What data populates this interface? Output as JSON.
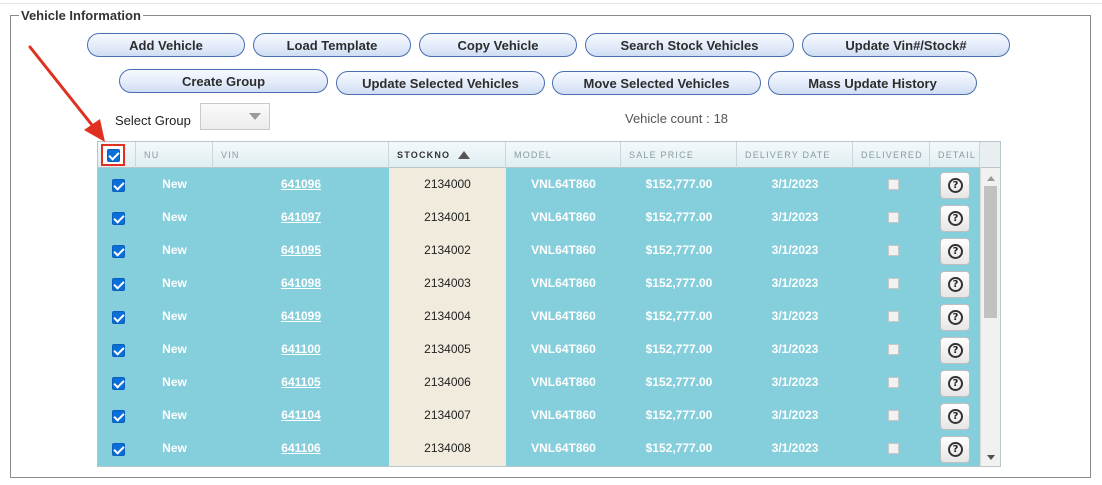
{
  "fieldset": {
    "legend": "Vehicle Information"
  },
  "toolbar": {
    "row1": [
      "Add Vehicle",
      "Load Template",
      "Copy Vehicle",
      "Search Stock Vehicles",
      "Update Vin#/Stock#"
    ],
    "row2": [
      "Create Group",
      "Update Selected Vehicles",
      "Move Selected Vehicles",
      "Mass Update History"
    ]
  },
  "select_group": {
    "label": "Select Group",
    "value": ""
  },
  "vehicle_count": {
    "label": "Vehicle count :",
    "value": "18"
  },
  "grid": {
    "columns": [
      "NU",
      "VIN",
      "STOCKNO",
      "MODEL",
      "SALE PRICE",
      "DELIVERY DATE",
      "DELIVERED",
      "DETAIL"
    ],
    "sorted_column": "STOCKNO",
    "sort_direction": "ascending",
    "header_checkbox_checked": true,
    "rows": [
      {
        "nu": "New",
        "vin": "641096",
        "stockno": "2134000",
        "model": "VNL64T860",
        "sale_price": "$152,777.00",
        "delivery_date": "3/1/2023",
        "delivered": false,
        "checked": true
      },
      {
        "nu": "New",
        "vin": "641097",
        "stockno": "2134001",
        "model": "VNL64T860",
        "sale_price": "$152,777.00",
        "delivery_date": "3/1/2023",
        "delivered": false,
        "checked": true
      },
      {
        "nu": "New",
        "vin": "641095",
        "stockno": "2134002",
        "model": "VNL64T860",
        "sale_price": "$152,777.00",
        "delivery_date": "3/1/2023",
        "delivered": false,
        "checked": true
      },
      {
        "nu": "New",
        "vin": "641098",
        "stockno": "2134003",
        "model": "VNL64T860",
        "sale_price": "$152,777.00",
        "delivery_date": "3/1/2023",
        "delivered": false,
        "checked": true
      },
      {
        "nu": "New",
        "vin": "641099",
        "stockno": "2134004",
        "model": "VNL64T860",
        "sale_price": "$152,777.00",
        "delivery_date": "3/1/2023",
        "delivered": false,
        "checked": true
      },
      {
        "nu": "New",
        "vin": "641100",
        "stockno": "2134005",
        "model": "VNL64T860",
        "sale_price": "$152,777.00",
        "delivery_date": "3/1/2023",
        "delivered": false,
        "checked": true
      },
      {
        "nu": "New",
        "vin": "641105",
        "stockno": "2134006",
        "model": "VNL64T860",
        "sale_price": "$152,777.00",
        "delivery_date": "3/1/2023",
        "delivered": false,
        "checked": true
      },
      {
        "nu": "New",
        "vin": "641104",
        "stockno": "2134007",
        "model": "VNL64T860",
        "sale_price": "$152,777.00",
        "delivery_date": "3/1/2023",
        "delivered": false,
        "checked": true
      },
      {
        "nu": "New",
        "vin": "641106",
        "stockno": "2134008",
        "model": "VNL64T860",
        "sale_price": "$152,777.00",
        "delivery_date": "3/1/2023",
        "delivered": false,
        "checked": true
      }
    ]
  },
  "icons": {
    "detail": "help-icon",
    "sort": "sort-ascending-icon",
    "annotation": "red-arrow-annotation"
  },
  "colors": {
    "row_bg": "#85cedb",
    "stock_col_bg": "#f1ebde",
    "annotation": "#e03020",
    "button_border": "#4a6fb0"
  }
}
